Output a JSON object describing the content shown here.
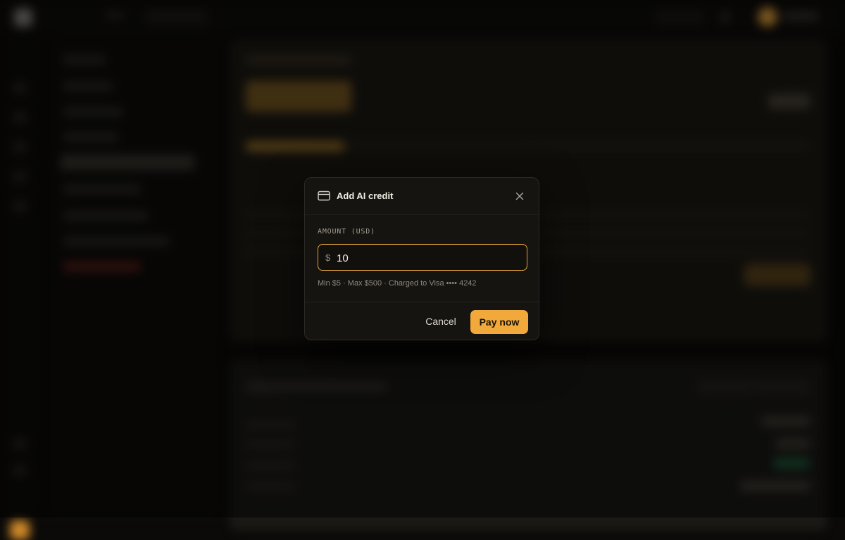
{
  "modal": {
    "title": "Add AI credit",
    "amount_label": "AMOUNT (USD)",
    "currency_symbol": "$",
    "amount_value": "10",
    "hint": "Min $5 · Max $500 · Charged to Visa •••• 4242",
    "cancel_label": "Cancel",
    "pay_label": "Pay now"
  },
  "colors": {
    "accent": "#f2a93b",
    "modal_bg": "#161410",
    "backdrop": "#0b0a08"
  },
  "icons": {
    "header": "credit-card-icon",
    "close": "close-icon"
  }
}
